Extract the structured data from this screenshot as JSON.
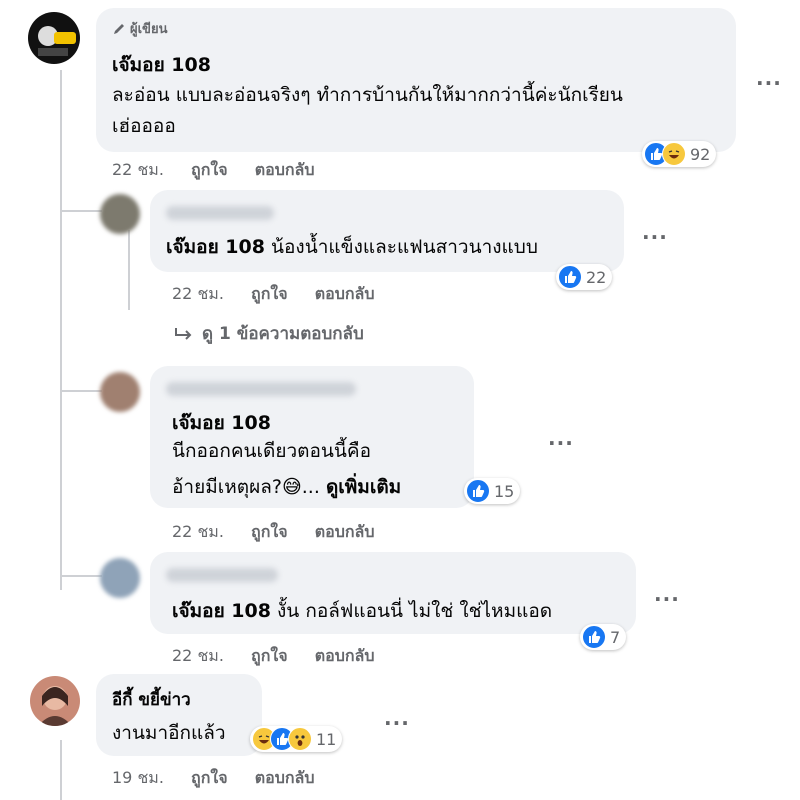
{
  "comments": [
    {
      "badge": "ผู้เขียน",
      "name": "เจ๊มอย 108",
      "text_line1": "ละอ่อน แบบละอ่อนจริงๆ ทำการบ้านกันให้มากกว่านี้ค่ะนักเรียน",
      "text_line2": "เฮ่ออออ",
      "time": "22 ชม.",
      "like_label": "ถูกใจ",
      "reply_label": "ตอบกลับ",
      "reaction_count": "92",
      "reactions": [
        "like-icon",
        "haha-icon"
      ]
    }
  ],
  "replies": [
    {
      "name": "เจ๊มอย 108",
      "text": "น้องน้ำแข็งและแฟนสาวนางแบบ",
      "time": "22 ชม.",
      "like_label": "ถูกใจ",
      "reply_label": "ตอบกลับ",
      "reaction_count": "22",
      "view_replies": "ดู 1 ข้อความตอบกลับ"
    },
    {
      "name": "เจ๊มอย 108",
      "text_line1": "นีกออกคนเดียวตอนนี้คือ",
      "text_line2": "อ้ายมีเหตุผล?😅...",
      "see_more": "ดูเพิ่มเติม",
      "time": "22 ชม.",
      "like_label": "ถูกใจ",
      "reply_label": "ตอบกลับ",
      "reaction_count": "15"
    },
    {
      "name": "เจ๊มอย 108",
      "text": "งั้น กอล์ฟแอนนี่ ไม่ใช่ ใช่ไหมแอด",
      "time": "22 ชม.",
      "like_label": "ถูกใจ",
      "reply_label": "ตอบกลับ",
      "reaction_count": "7"
    }
  ],
  "comment2": {
    "name": "อีกี้ ขยี้ข่าว",
    "text": "งานมาอีกแล้ว",
    "time": "19 ชม.",
    "like_label": "ถูกใจ",
    "reply_label": "ตอบกลับ",
    "reaction_count": "11"
  },
  "more_label": "...",
  "colors": {
    "like": "#1877f2",
    "haha": "#f7c83d",
    "bubble": "#f0f2f5",
    "meta": "#65676b"
  }
}
